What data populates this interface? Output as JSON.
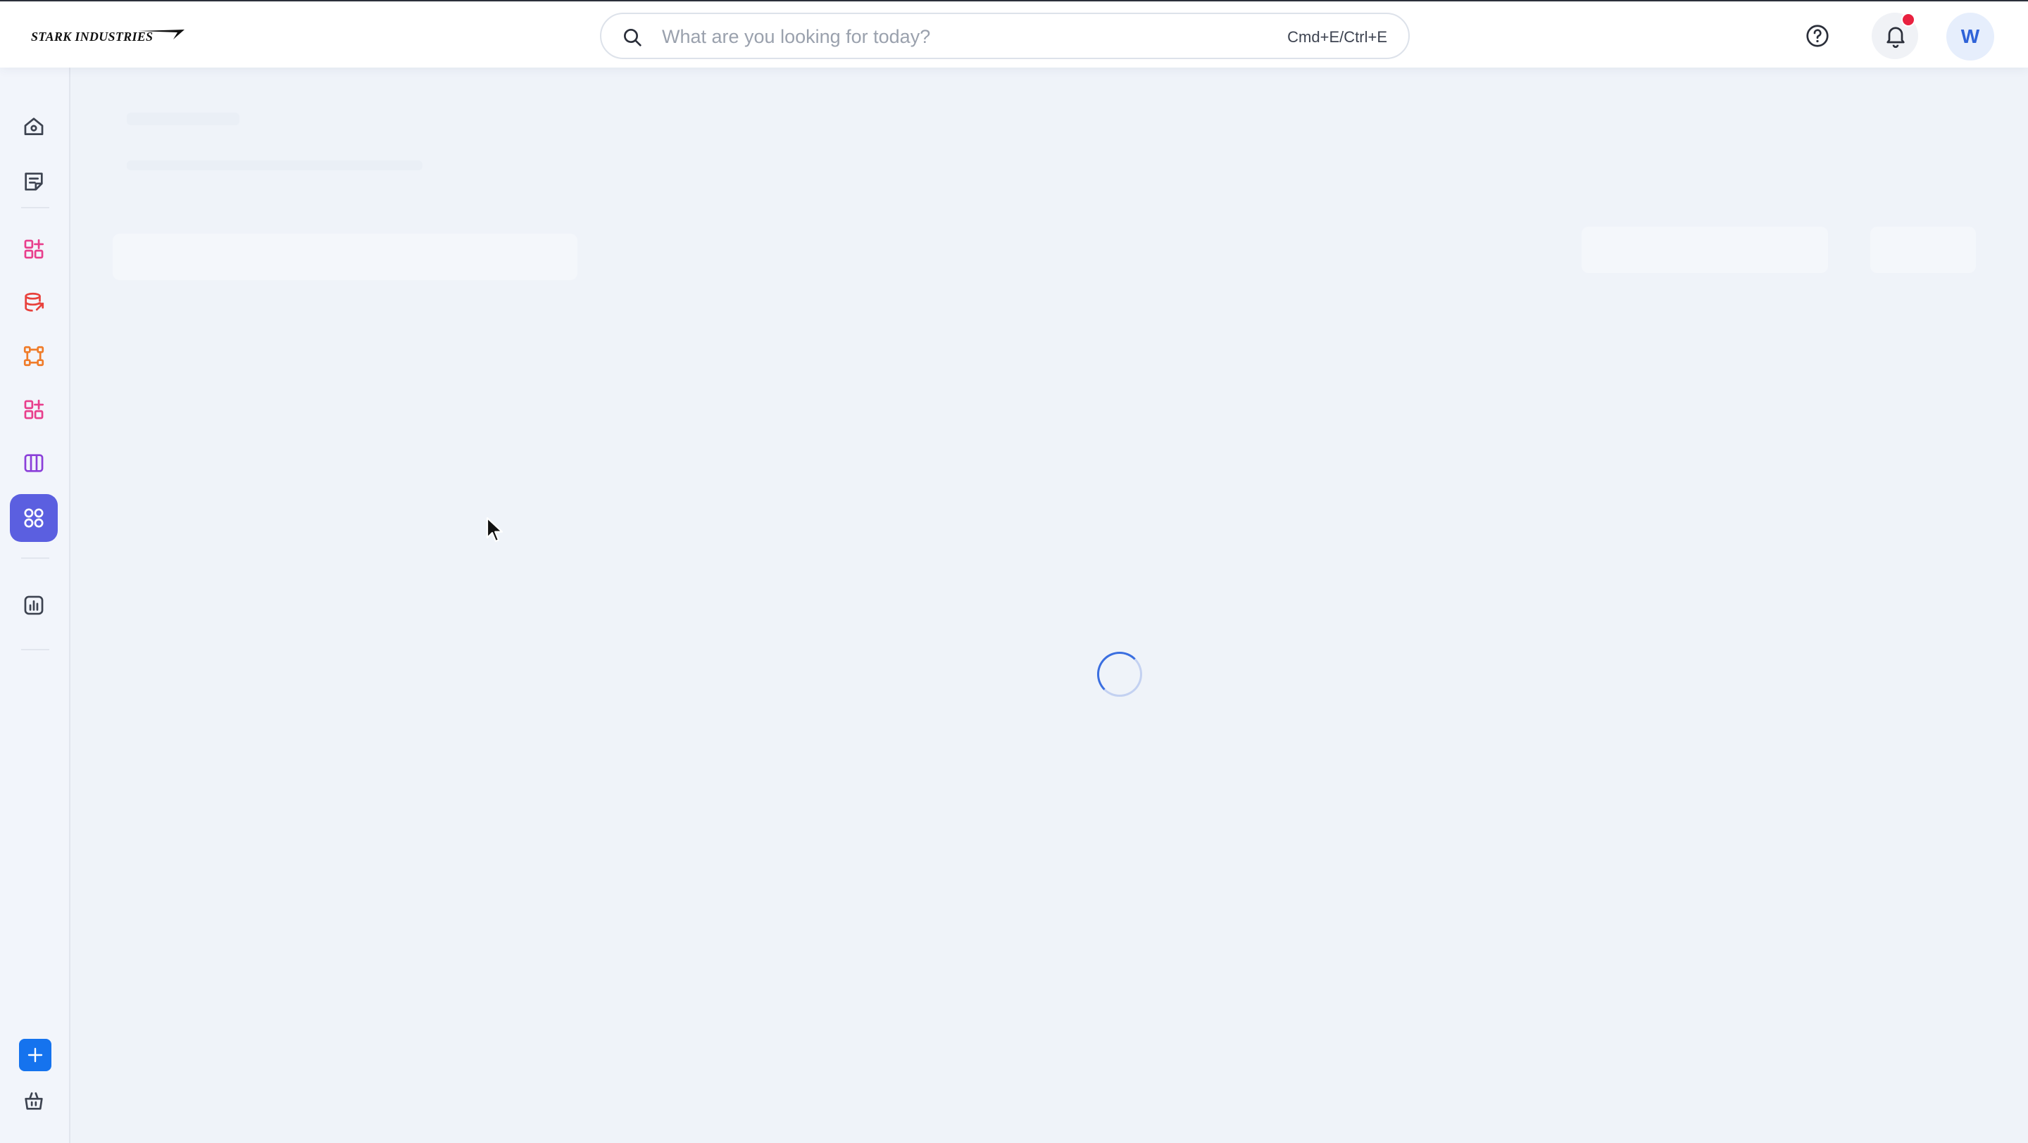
{
  "header": {
    "logo_text": "STARK INDUSTRIES",
    "search": {
      "placeholder": "What are you looking for today?",
      "shortcut": "Cmd+E/Ctrl+E"
    },
    "help_icon": "help-circle-icon",
    "notification_icon": "bell-icon",
    "has_unread_notifications": true,
    "avatar_initial": "W"
  },
  "sidebar": {
    "items": [
      {
        "id": "home",
        "icon": "home-icon",
        "color": "#3d4350",
        "active": false
      },
      {
        "id": "notes",
        "icon": "notes-icon",
        "color": "#3d4350",
        "active": false
      },
      {
        "id": "apps-add",
        "icon": "grid-plus-icon",
        "color": "#e83e8c",
        "active": false
      },
      {
        "id": "data",
        "icon": "database-icon",
        "color": "#e8413c",
        "active": false
      },
      {
        "id": "workflow",
        "icon": "workflow-icon",
        "color": "#f07c2a",
        "active": false
      },
      {
        "id": "components",
        "icon": "grid-plus-icon",
        "color": "#e83e8c",
        "active": false
      },
      {
        "id": "columns",
        "icon": "columns-icon",
        "color": "#8b3fd9",
        "active": false
      },
      {
        "id": "apps",
        "icon": "apps-icon",
        "color": "#ffffff",
        "active": true
      },
      {
        "id": "analytics",
        "icon": "chart-icon",
        "color": "#3d4350",
        "active": false
      }
    ],
    "add_icon": "plus-icon",
    "store_icon": "basket-icon"
  },
  "colors": {
    "accent": "#5b5fe0",
    "primary": "#1573ee",
    "notification": "#e8213f",
    "background": "#eff3f9"
  },
  "main": {
    "state": "loading"
  }
}
